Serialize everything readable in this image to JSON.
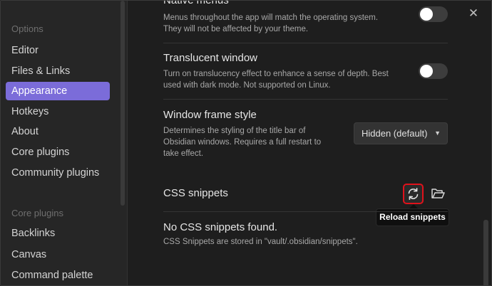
{
  "sidebar": {
    "options_header": "Options",
    "options_items": [
      {
        "label": "Editor",
        "active": false
      },
      {
        "label": "Files & Links",
        "active": false
      },
      {
        "label": "Appearance",
        "active": true
      },
      {
        "label": "Hotkeys",
        "active": false
      },
      {
        "label": "About",
        "active": false
      },
      {
        "label": "Core plugins",
        "active": false
      },
      {
        "label": "Community plugins",
        "active": false
      }
    ],
    "core_plugins_header": "Core plugins",
    "core_plugins_items": [
      {
        "label": "Backlinks"
      },
      {
        "label": "Canvas"
      },
      {
        "label": "Command palette"
      }
    ]
  },
  "settings": {
    "native_menus": {
      "name": "Native menus",
      "desc_line1": "Menus throughout the app will match the operating system.",
      "desc_line2": "They will not be affected by your theme.",
      "enabled": false
    },
    "translucent_window": {
      "name": "Translucent window",
      "desc_line1": "Turn on translucency effect to enhance a sense of depth. Best",
      "desc_line2": "used with dark mode. Not supported on Linux.",
      "enabled": false
    },
    "window_frame_style": {
      "name": "Window frame style",
      "desc_line1": "Determines the styling of the title bar of",
      "desc_line2": "Obsidian windows. Requires a full restart to",
      "desc_line3": "take effect.",
      "selected": "Hidden (default)"
    }
  },
  "css_snippets": {
    "title": "CSS snippets",
    "reload_tooltip": "Reload snippets",
    "empty_title": "No CSS snippets found.",
    "empty_desc": "CSS Snippets are stored in \"vault/.obsidian/snippets\"."
  },
  "icons": {
    "close": "close-icon",
    "reload": "refresh-icon",
    "folder": "folder-icon",
    "chevron": "chevron-down-icon"
  },
  "colors": {
    "accent": "#7b6cd9",
    "highlight_border": "#e0121b",
    "background": "#1e1e1e",
    "sidebar_background": "#262626"
  }
}
